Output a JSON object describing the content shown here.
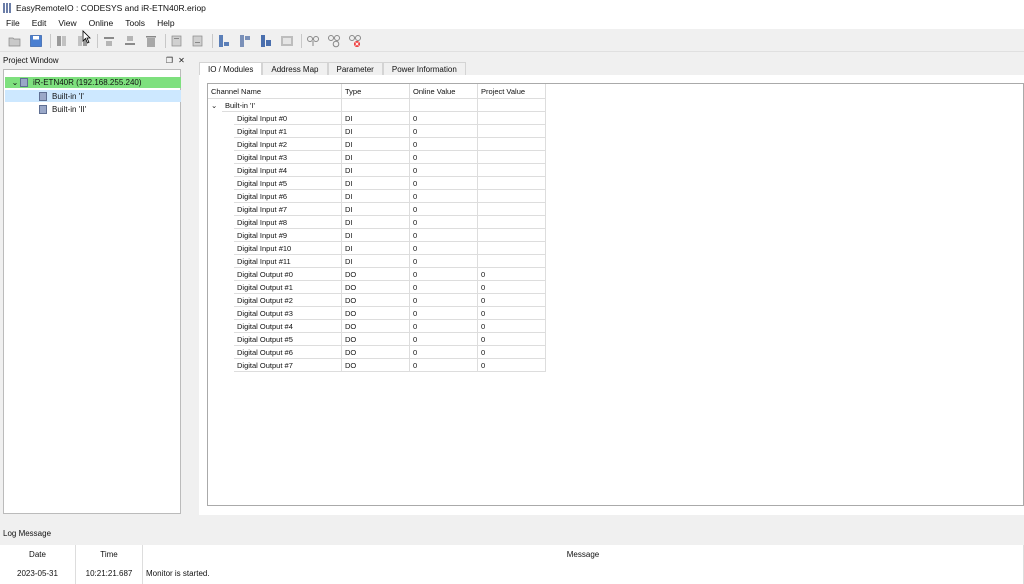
{
  "window": {
    "title": "EasyRemoteIO : CODESYS and iR-ETN40R.eriop"
  },
  "menu": [
    "File",
    "Edit",
    "View",
    "Online",
    "Tools",
    "Help"
  ],
  "toolbar": [
    "open-folder-icon",
    "save-icon",
    "separator",
    "module-left-icon",
    "module-right-icon",
    "separator",
    "align-top-icon",
    "align-bottom-icon",
    "delete-icon",
    "separator",
    "import-icon",
    "export-icon",
    "separator",
    "upload-icon",
    "download-icon",
    "upload-module-icon",
    "module-grid-icon",
    "separator",
    "connect-icon",
    "disconnect-icon",
    "stop-monitor-icon"
  ],
  "project": {
    "title": "Project Window",
    "root": "iR-ETN40R (192.168.255.240)",
    "children": [
      "Built-in 'I'",
      "Built-in 'II'"
    ],
    "selected": 0
  },
  "tabs": [
    "IO / Modules",
    "Address Map",
    "Parameter",
    "Power Information"
  ],
  "grid": {
    "headers": [
      "Channel Name",
      "Type",
      "Online Value",
      "Project Value"
    ],
    "group": "Built-in 'I'",
    "rows": [
      [
        "Digital Input #0",
        "DI",
        "0",
        ""
      ],
      [
        "Digital Input #1",
        "DI",
        "0",
        ""
      ],
      [
        "Digital Input #2",
        "DI",
        "0",
        ""
      ],
      [
        "Digital Input #3",
        "DI",
        "0",
        ""
      ],
      [
        "Digital Input #4",
        "DI",
        "0",
        ""
      ],
      [
        "Digital Input #5",
        "DI",
        "0",
        ""
      ],
      [
        "Digital Input #6",
        "DI",
        "0",
        ""
      ],
      [
        "Digital Input #7",
        "DI",
        "0",
        ""
      ],
      [
        "Digital Input #8",
        "DI",
        "0",
        ""
      ],
      [
        "Digital Input #9",
        "DI",
        "0",
        ""
      ],
      [
        "Digital Input #10",
        "DI",
        "0",
        ""
      ],
      [
        "Digital Input #11",
        "DI",
        "0",
        ""
      ],
      [
        "Digital Output #0",
        "DO",
        "0",
        "0"
      ],
      [
        "Digital Output #1",
        "DO",
        "0",
        "0"
      ],
      [
        "Digital Output #2",
        "DO",
        "0",
        "0"
      ],
      [
        "Digital Output #3",
        "DO",
        "0",
        "0"
      ],
      [
        "Digital Output #4",
        "DO",
        "0",
        "0"
      ],
      [
        "Digital Output #5",
        "DO",
        "0",
        "0"
      ],
      [
        "Digital Output #6",
        "DO",
        "0",
        "0"
      ],
      [
        "Digital Output #7",
        "DO",
        "0",
        "0"
      ]
    ]
  },
  "log": {
    "title": "Log Message",
    "headers": [
      "Date",
      "Time",
      "Message"
    ],
    "rows": [
      [
        "2023-05-31",
        "10:21:21.687",
        "Monitor is started."
      ]
    ]
  },
  "colors": {
    "root_highlight": "#7ee07e",
    "selection": "#cde8ff"
  }
}
